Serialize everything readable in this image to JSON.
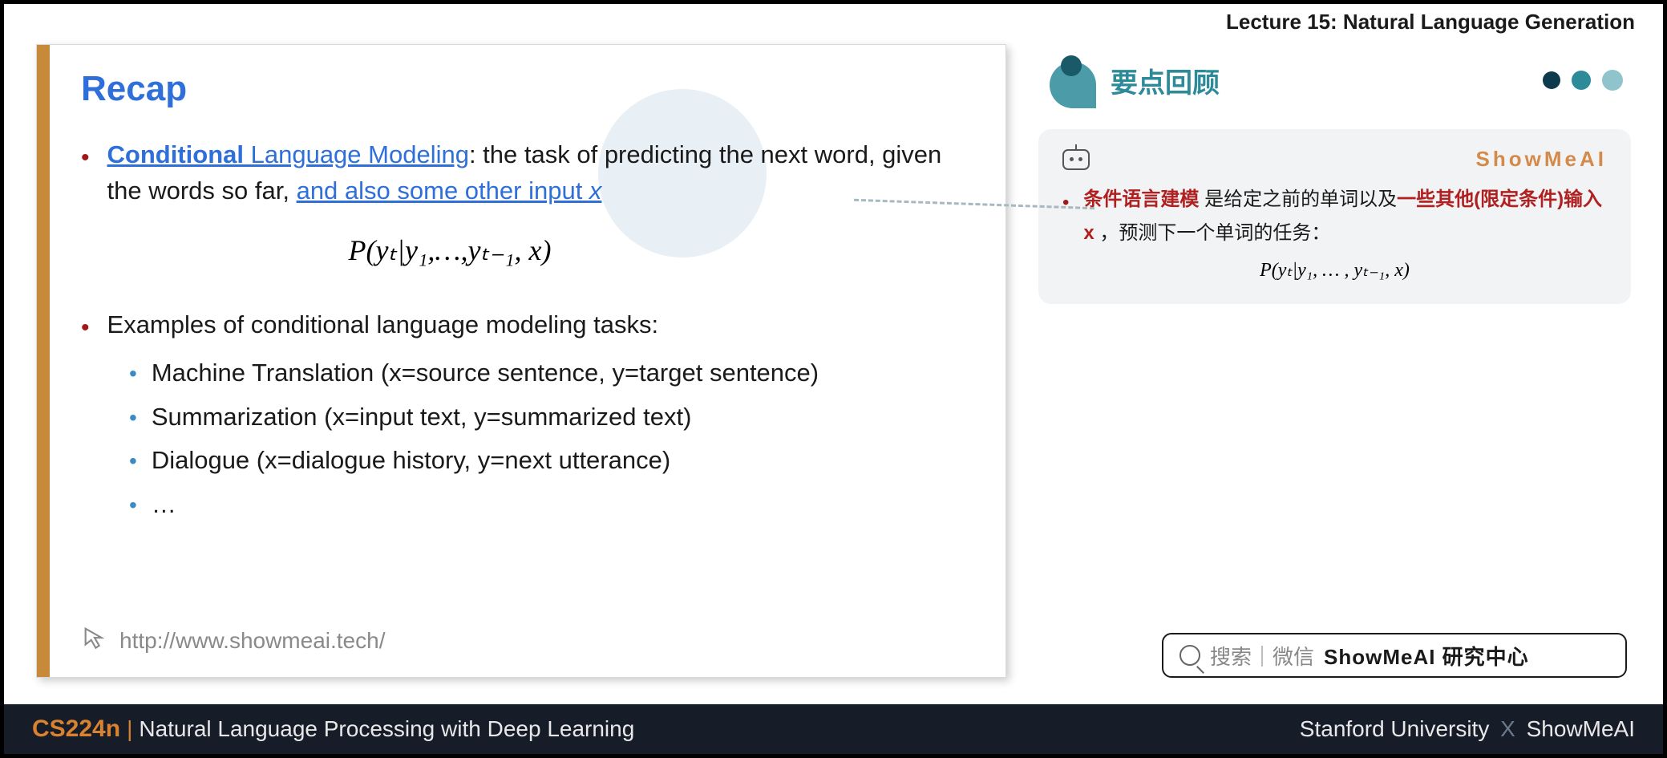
{
  "header": {
    "lecture_title": "Lecture 15: Natural Language Generation"
  },
  "slide": {
    "title": "Recap",
    "point1_bold": "Conditional",
    "point1_ul": " Language Modeling",
    "point1_rest1": ": the task of predicting the next word, given the words so far, ",
    "point1_ul2": "and also some other input ",
    "point1_ul2_italic": "x",
    "formula": "P(yₜ|y₁,…,yₜ₋₁, x)",
    "point2": "Examples of conditional language modeling tasks:",
    "subs": [
      "Machine Translation (x=source sentence, y=target sentence)",
      "Summarization (x=input text, y=summarized text)",
      "Dialogue (x=dialogue history, y=next utterance)",
      "…"
    ],
    "footer_link": "http://www.showmeai.tech/"
  },
  "right": {
    "title": "要点回顾",
    "brand": "ShowMeAI",
    "note_red1": "条件语言建模",
    "note_plain1": " 是给定之前的单词以及",
    "note_red2": "一些其他(限定条件)输入 x ",
    "note_plain2": "，预测下一个单词的任务：",
    "note_formula": "P(yₜ|y₁, … , yₜ₋₁, x)"
  },
  "search": {
    "prefix_gray": "搜索｜微信",
    "bold_text": "ShowMeAI 研究中心"
  },
  "footer": {
    "code": "CS224n",
    "divider": "|",
    "name": "Natural Language Processing with Deep Learning",
    "right_a": "Stanford University",
    "right_x": "X",
    "right_b": "ShowMeAI"
  }
}
